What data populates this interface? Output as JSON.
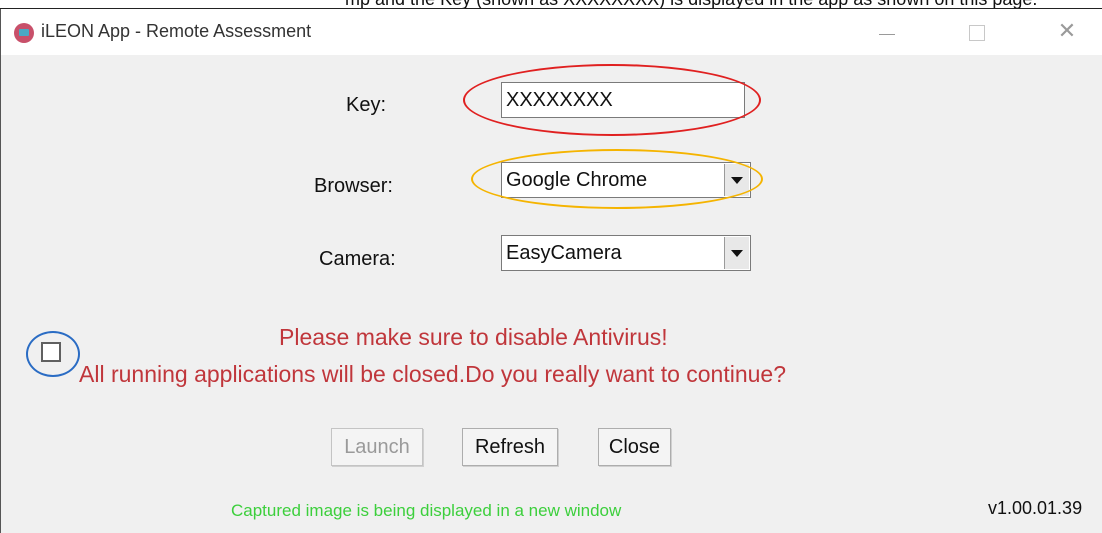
{
  "header_text": "mp and the Key (shown as XXXXXXXX) is displayed in the app as shown on this page.",
  "window": {
    "title": "iLEON App - Remote Assessment"
  },
  "form": {
    "key_label": "Key:",
    "key_value": "XXXXXXXX",
    "browser_label": "Browser:",
    "browser_value": "Google Chrome",
    "camera_label": "Camera:",
    "camera_value": "EasyCamera"
  },
  "warning": {
    "line1": "Please make sure to disable Antivirus!",
    "line2": "All running applications will be closed.Do you really want to continue?",
    "checked": false
  },
  "buttons": {
    "launch": "Launch",
    "launch_enabled": false,
    "refresh": "Refresh",
    "close": "Close"
  },
  "status_message": "Captured image is being displayed in a new window",
  "version": "v1.00.01.39",
  "colors": {
    "warning_text": "#c0363b",
    "status_text": "#3ccf3c",
    "key_highlight": "#e02020",
    "browser_highlight": "#f5b400",
    "checkbox_highlight": "#2a6cc4"
  },
  "icons": {
    "app": "app-logo-icon",
    "minimize": "minimize-icon",
    "maximize": "maximize-icon",
    "close": "close-icon",
    "dropdown": "chevron-down-icon"
  }
}
